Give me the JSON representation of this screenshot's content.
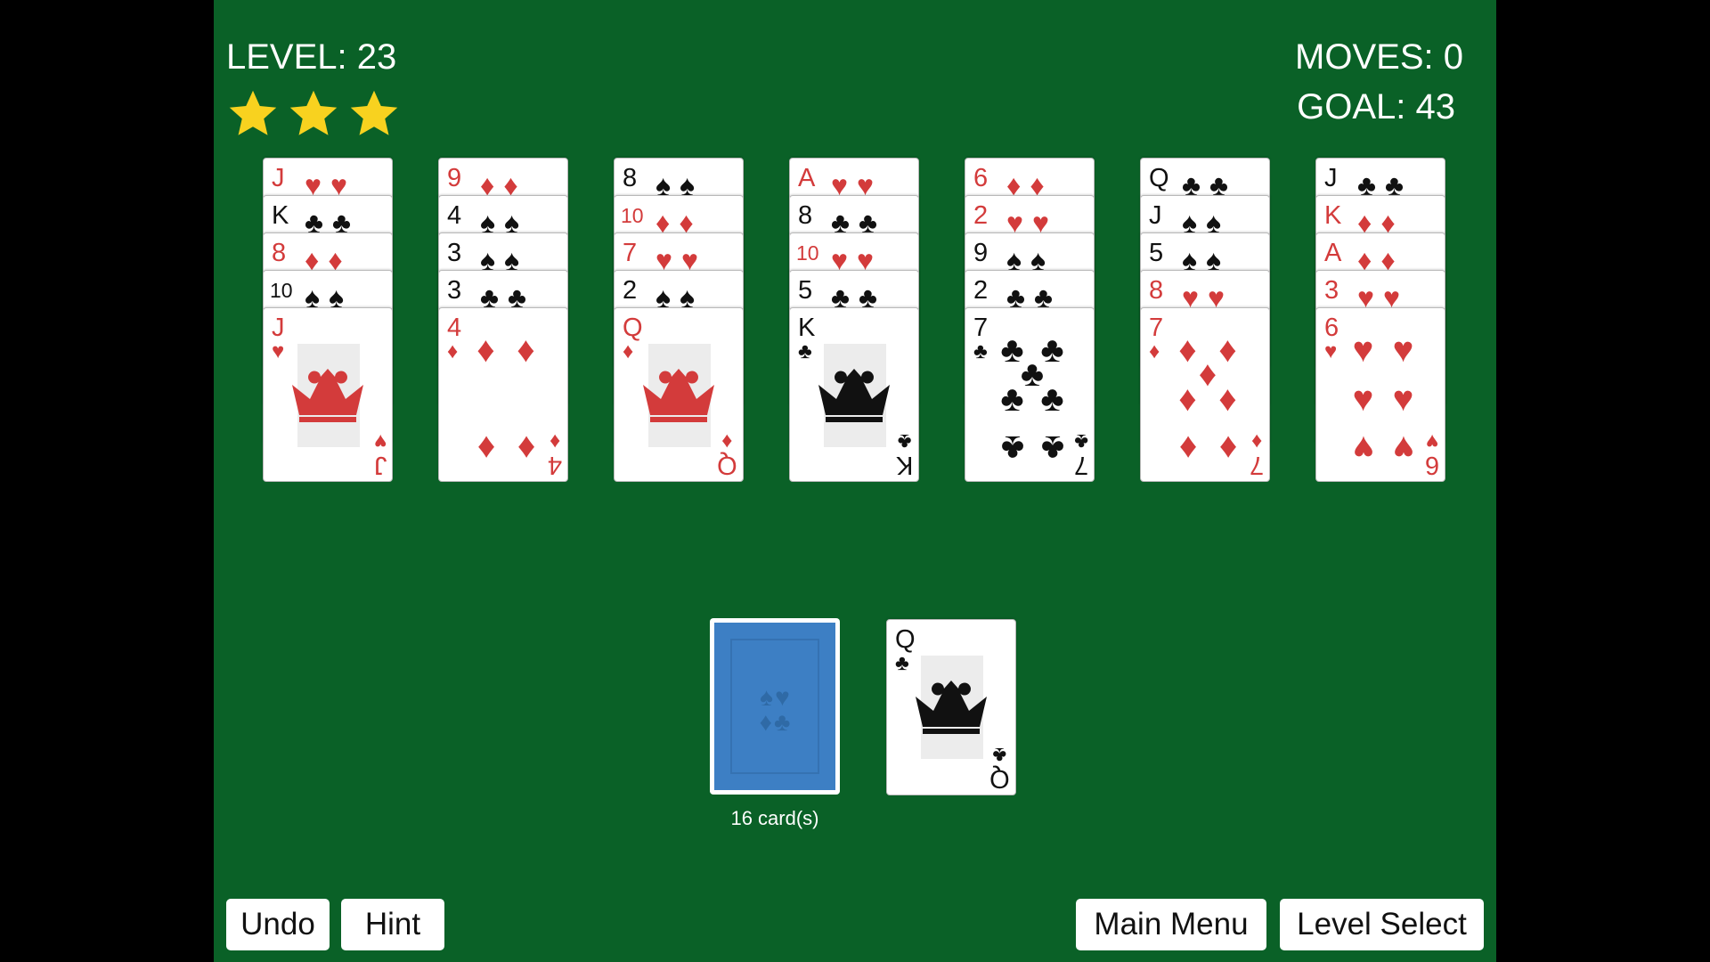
{
  "hud": {
    "level": "LEVEL: 23",
    "moves": "MOVES: 0",
    "goal": "GOAL: 43",
    "stars_earned": 3
  },
  "colors": {
    "table": "#0a6127",
    "red_suit": "#d33b3b",
    "black_suit": "#111111",
    "card_back": "#3d7fc4",
    "star": "#f8d21f"
  },
  "columns": [
    {
      "cards": [
        {
          "rank": "J",
          "suit": "hearts"
        },
        {
          "rank": "K",
          "suit": "clubs"
        },
        {
          "rank": "8",
          "suit": "diamonds"
        },
        {
          "rank": "10",
          "suit": "spades"
        },
        {
          "rank": "J",
          "suit": "hearts"
        }
      ]
    },
    {
      "cards": [
        {
          "rank": "9",
          "suit": "diamonds"
        },
        {
          "rank": "4",
          "suit": "spades"
        },
        {
          "rank": "3",
          "suit": "spades"
        },
        {
          "rank": "3",
          "suit": "clubs"
        },
        {
          "rank": "4",
          "suit": "diamonds"
        }
      ]
    },
    {
      "cards": [
        {
          "rank": "8",
          "suit": "spades"
        },
        {
          "rank": "10",
          "suit": "diamonds"
        },
        {
          "rank": "7",
          "suit": "hearts"
        },
        {
          "rank": "2",
          "suit": "spades"
        },
        {
          "rank": "Q",
          "suit": "diamonds"
        }
      ]
    },
    {
      "cards": [
        {
          "rank": "A",
          "suit": "hearts"
        },
        {
          "rank": "8",
          "suit": "clubs"
        },
        {
          "rank": "10",
          "suit": "hearts"
        },
        {
          "rank": "5",
          "suit": "clubs"
        },
        {
          "rank": "K",
          "suit": "clubs"
        }
      ]
    },
    {
      "cards": [
        {
          "rank": "6",
          "suit": "diamonds"
        },
        {
          "rank": "2",
          "suit": "hearts"
        },
        {
          "rank": "9",
          "suit": "spades"
        },
        {
          "rank": "2",
          "suit": "clubs"
        },
        {
          "rank": "7",
          "suit": "clubs"
        }
      ]
    },
    {
      "cards": [
        {
          "rank": "Q",
          "suit": "clubs"
        },
        {
          "rank": "J",
          "suit": "spades"
        },
        {
          "rank": "5",
          "suit": "spades"
        },
        {
          "rank": "8",
          "suit": "hearts"
        },
        {
          "rank": "7",
          "suit": "diamonds"
        }
      ]
    },
    {
      "cards": [
        {
          "rank": "J",
          "suit": "clubs"
        },
        {
          "rank": "K",
          "suit": "diamonds"
        },
        {
          "rank": "A",
          "suit": "diamonds"
        },
        {
          "rank": "3",
          "suit": "hearts"
        },
        {
          "rank": "6",
          "suit": "hearts"
        }
      ]
    }
  ],
  "stock": {
    "count_label": "16 card(s)"
  },
  "waste": {
    "rank": "Q",
    "suit": "clubs"
  },
  "buttons": {
    "undo": "Undo",
    "hint": "Hint",
    "main_menu": "Main Menu",
    "level_select": "Level Select"
  }
}
